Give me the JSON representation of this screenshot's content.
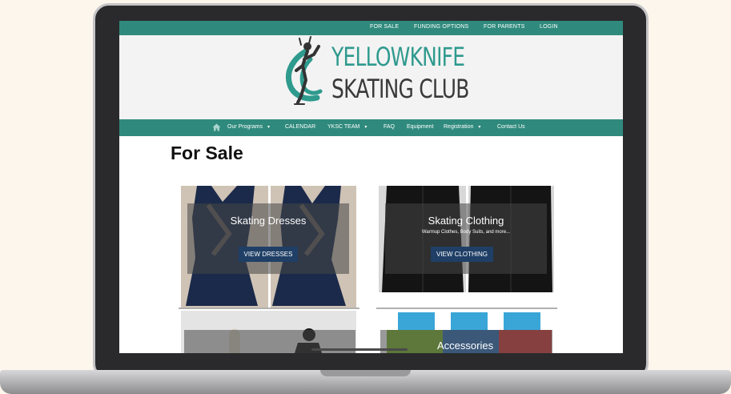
{
  "top_nav": [
    "FOR SALE",
    "FUNDING OPTIONS",
    "FOR PARENTS",
    "LOGIN"
  ],
  "logo": {
    "line1": "YELLOWKNIFE",
    "line2": "SKATING CLUB"
  },
  "main_nav": {
    "items": [
      "Our Programs",
      "CALENDAR",
      "YKSC TEAM",
      "FAQ",
      "Equipment",
      "Registration",
      "Contact Us"
    ],
    "caret": "▾",
    "home_icon": "home-icon"
  },
  "page": {
    "title": "For Sale"
  },
  "cards": [
    {
      "title": "Skating Dresses",
      "subtitle": "",
      "button": "VIEW DRESSES"
    },
    {
      "title": "Skating Clothing",
      "subtitle": "Warmup Clothes, Body Suits, and more...",
      "button": "VIEW CLOTHING"
    },
    {
      "title": "",
      "subtitle": "",
      "button": ""
    },
    {
      "title": "Accessories",
      "subtitle": "",
      "button": ""
    }
  ],
  "colors": {
    "teal": "#2f8a7d",
    "logo_teal": "#2f9a8e",
    "button_navy": "#1f3f66",
    "background": "#fdf6ec"
  }
}
